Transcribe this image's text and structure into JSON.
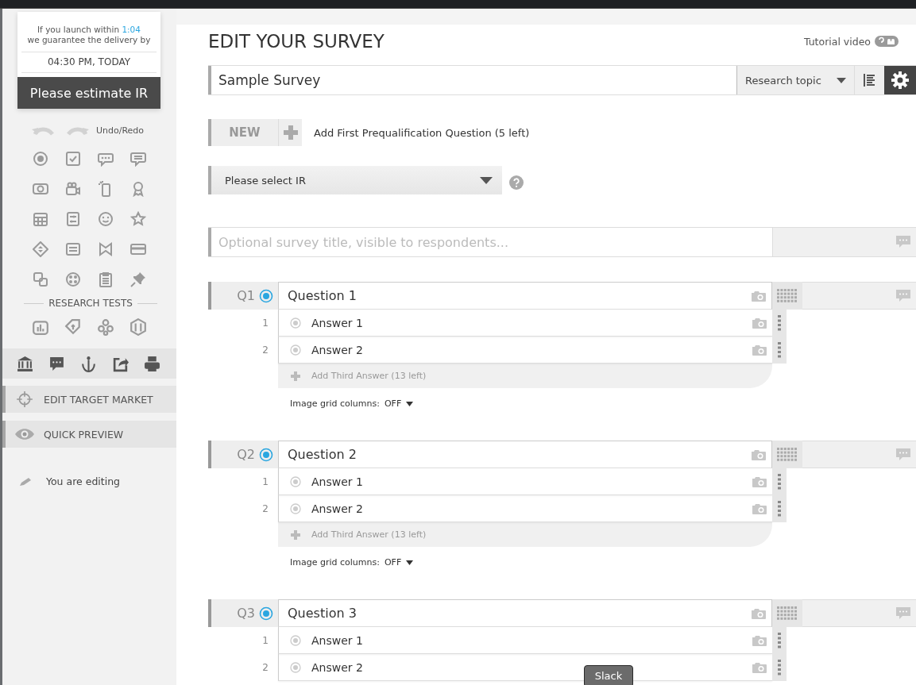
{
  "delivery": {
    "note_start": "If you launch within",
    "countdown": "1:04",
    "note_end": "we guarantee the delivery by",
    "time": "04:30 PM, TODAY",
    "button": "Please estimate IR"
  },
  "undo_redo_label": "Undo/Redo",
  "research_tests_label": "RESEARCH TESTS",
  "sidebar_nav": [
    {
      "label": "EDIT TARGET MARKET",
      "kind": "target"
    },
    {
      "label": "QUICK PREVIEW",
      "kind": "eye"
    }
  ],
  "editing_status": "You are editing",
  "title": "EDIT YOUR SURVEY",
  "tutorial_link": "Tutorial video",
  "survey_name": "Sample Survey",
  "research_topic": "Research topic",
  "new_button": "NEW",
  "add_prequal": "Add First Prequalification Question (5 left)",
  "ir_select": "Please select IR",
  "survey_title_placeholder": "Optional survey title, visible to respondents...",
  "questions": [
    {
      "number": "Q1",
      "text": "Question 1",
      "answers": [
        {
          "number": "1",
          "text": "Answer 1"
        },
        {
          "number": "2",
          "text": "Answer 2"
        }
      ],
      "add_answer": "Add Third Answer (13 left)",
      "grid_label": "Image grid columns:",
      "grid_value": "OFF"
    },
    {
      "number": "Q2",
      "text": "Question 2",
      "answers": [
        {
          "number": "1",
          "text": "Answer 1"
        },
        {
          "number": "2",
          "text": "Answer 2"
        }
      ],
      "add_answer": "Add Third Answer (13 left)",
      "grid_label": "Image grid columns:",
      "grid_value": "OFF"
    },
    {
      "number": "Q3",
      "text": "Question 3",
      "answers": [
        {
          "number": "1",
          "text": "Answer 1"
        },
        {
          "number": "2",
          "text": "Answer 2"
        }
      ]
    }
  ],
  "tooltip": "Slack"
}
